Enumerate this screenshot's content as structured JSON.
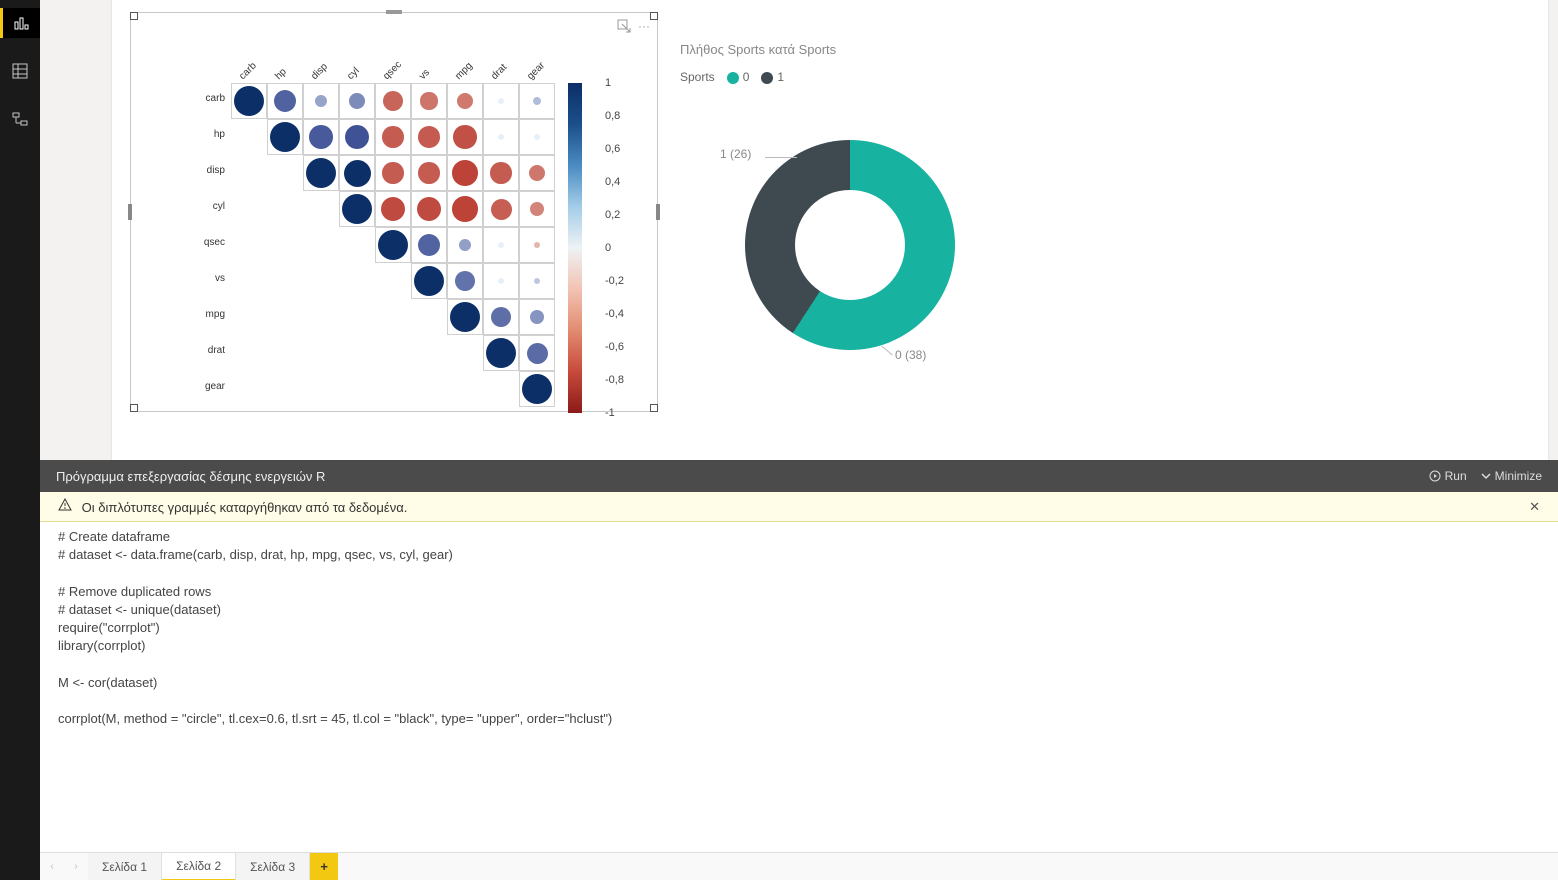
{
  "sidebar_icons": [
    "report",
    "data",
    "model"
  ],
  "chart_data": [
    {
      "type": "heatmap",
      "shape": "upper-triangular",
      "method": "circle",
      "variables": [
        "carb",
        "hp",
        "disp",
        "cyl",
        "qsec",
        "vs",
        "mpg",
        "drat",
        "gear"
      ],
      "values": [
        [
          1.0,
          0.75,
          0.4,
          0.53,
          -0.66,
          -0.57,
          -0.55,
          0.0,
          0.27
        ],
        [
          null,
          1.0,
          0.79,
          0.83,
          -0.71,
          -0.72,
          -0.78,
          0.0,
          0.0
        ],
        [
          null,
          null,
          1.0,
          0.9,
          -0.71,
          -0.71,
          -0.85,
          -0.71,
          -0.56
        ],
        [
          null,
          null,
          null,
          1.0,
          -0.81,
          -0.81,
          -0.85,
          -0.7,
          -0.49
        ],
        [
          null,
          null,
          null,
          null,
          1.0,
          0.74,
          0.42,
          0.0,
          -0.21
        ],
        [
          null,
          null,
          null,
          null,
          null,
          1.0,
          0.66,
          0.0,
          0.21
        ],
        [
          null,
          null,
          null,
          null,
          null,
          null,
          1.0,
          0.68,
          0.48
        ],
        [
          null,
          null,
          null,
          null,
          null,
          null,
          null,
          1.0,
          0.7
        ],
        [
          null,
          null,
          null,
          null,
          null,
          null,
          null,
          null,
          1.0
        ]
      ],
      "legend_ticks": [
        "1",
        "0,8",
        "0,6",
        "0,4",
        "0,2",
        "0",
        "-0,2",
        "-0,4",
        "-0,6",
        "-0,8",
        "-1"
      ],
      "zlim": [
        -1,
        1
      ]
    },
    {
      "type": "pie",
      "style": "donut",
      "title": "Πλήθος Sports κατά Sports",
      "legend_title": "Sports",
      "series": [
        {
          "name": "0",
          "value": 38,
          "color": "#17b2a0",
          "label": "0 (38)"
        },
        {
          "name": "1",
          "value": 26,
          "color": "#3e4a50",
          "label": "1 (26)"
        }
      ]
    }
  ],
  "script_panel": {
    "title": "Πρόγραμμα επεξεργασίας δέσμης ενεργειών R",
    "run_label": "Run",
    "minimize_label": "Minimize",
    "warning_text": "Οι διπλότυπες γραμμές καταργήθηκαν από τα δεδομένα.",
    "code": "# Create dataframe\n# dataset <- data.frame(carb, disp, drat, hp, mpg, qsec, vs, cyl, gear)\n\n# Remove duplicated rows\n# dataset <- unique(dataset)\nrequire(\"corrplot\")\nlibrary(corrplot)\n\nM <- cor(dataset)\n\ncorrplot(M, method = \"circle\", tl.cex=0.6, tl.srt = 45, tl.col = \"black\", type= \"upper\", order=\"hclust\")"
  },
  "pages": {
    "prev": "‹",
    "next": "›",
    "tabs": [
      {
        "label": "Σελίδα 1",
        "active": false
      },
      {
        "label": "Σελίδα 2",
        "active": true
      },
      {
        "label": "Σελίδα 3",
        "active": false
      }
    ],
    "add": "+"
  },
  "close_x": "✕"
}
